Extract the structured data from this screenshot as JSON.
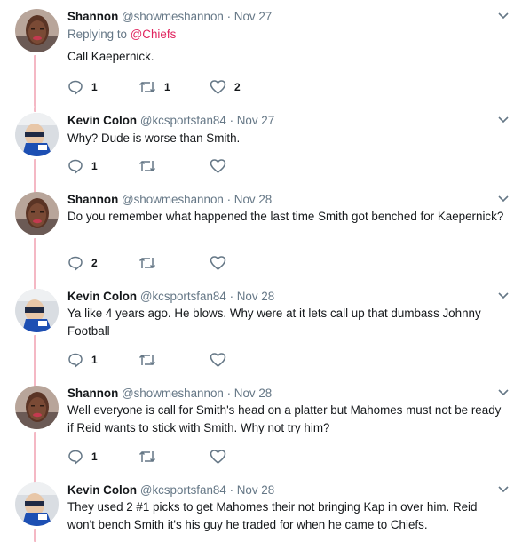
{
  "colors": {
    "text": "#14171a",
    "muted": "#657786",
    "mention": "#e0245e",
    "thread_line": "#f4b8c4",
    "icon": "#657786"
  },
  "tweets": [
    {
      "name": "Shannon",
      "handle": "@showmeshannon",
      "sep": "·",
      "time": "Nov 27",
      "reply_prefix": "Replying to ",
      "reply_mention": "@Chiefs",
      "text": "Call Kaepernick.",
      "reply_count": "1",
      "retweet_count": "1",
      "like_count": "2",
      "avatar": "shannon"
    },
    {
      "name": "Kevin Colon",
      "handle": "@kcsportsfan84",
      "sep": "·",
      "time": "Nov 27",
      "text": "Why? Dude is worse than Smith.",
      "reply_count": "1",
      "retweet_count": "",
      "like_count": "",
      "avatar": "kevin"
    },
    {
      "name": "Shannon",
      "handle": "@showmeshannon",
      "sep": "·",
      "time": "Nov 28",
      "text": "Do you remember what happened the last time Smith got benched for Kaepernick?",
      "reply_count": "2",
      "retweet_count": "",
      "like_count": "",
      "avatar": "shannon"
    },
    {
      "name": "Kevin Colon",
      "handle": "@kcsportsfan84",
      "sep": "·",
      "time": "Nov 28",
      "text": "Ya like 4 years ago. He blows. Why were at it lets call up that dumbass Johnny Football",
      "reply_count": "1",
      "retweet_count": "",
      "like_count": "",
      "avatar": "kevin"
    },
    {
      "name": "Shannon",
      "handle": "@showmeshannon",
      "sep": "·",
      "time": "Nov 28",
      "text": "Well everyone is call for Smith's head on a platter but Mahomes must not be ready if Reid wants to stick with Smith.  Why not try him?",
      "reply_count": "1",
      "retweet_count": "",
      "like_count": "",
      "avatar": "shannon"
    },
    {
      "name": "Kevin Colon",
      "handle": "@kcsportsfan84",
      "sep": "·",
      "time": "Nov 28",
      "text": "They used 2 #1 picks to get Mahomes their not bringing Kap in over him.  Reid won't bench Smith it's his guy he traded for when he came to Chiefs.",
      "reply_count": "",
      "retweet_count": "",
      "like_count": "",
      "avatar": "kevin"
    }
  ]
}
